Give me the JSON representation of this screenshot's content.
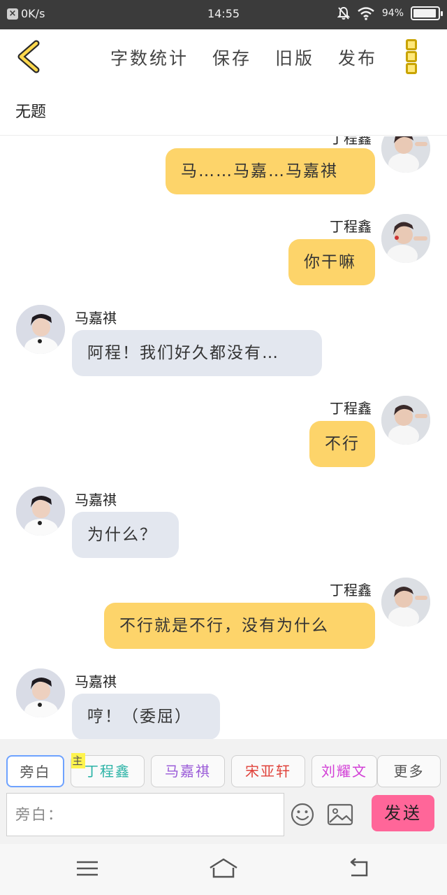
{
  "status_bar": {
    "speed": "0K/s",
    "time": "14:55",
    "battery": "94%",
    "battery_level": 0.94
  },
  "header": {
    "nav": [
      "字数统计",
      "保存",
      "旧版",
      "发布"
    ],
    "title": "无题"
  },
  "messages": [
    {
      "side": "right",
      "name": "丁程鑫",
      "text": "马……马嘉…马嘉祺"
    },
    {
      "side": "right",
      "name": "丁程鑫",
      "text": "你干嘛"
    },
    {
      "side": "left",
      "name": "马嘉祺",
      "text": "阿程！我们好久都没有…"
    },
    {
      "side": "right",
      "name": "丁程鑫",
      "text": "不行"
    },
    {
      "side": "left",
      "name": "马嘉祺",
      "text": "为什么？"
    },
    {
      "side": "right",
      "name": "丁程鑫",
      "text": "不行就是不行，没有为什么"
    },
    {
      "side": "left",
      "name": "马嘉祺",
      "text": "哼！（委屈）"
    }
  ],
  "toolbar": {
    "chips": [
      {
        "label": "旁白",
        "color": "#555555"
      },
      {
        "label": "丁程鑫",
        "color": "#2bb3a6",
        "tag": "主"
      },
      {
        "label": "马嘉祺",
        "color": "#9a5bd8"
      },
      {
        "label": "宋亚轩",
        "color": "#e0423a"
      },
      {
        "label": "刘耀文",
        "color": "#d23fd6"
      }
    ],
    "more_label": "更多",
    "input_placeholder": "旁白：",
    "send_label": "发送"
  },
  "icons": {
    "back": "back-chevron-icon",
    "more": "more-menu-icon",
    "emoji": "emoji-icon",
    "image": "image-icon",
    "nav_menu": "menu-icon",
    "nav_home": "home-icon",
    "nav_back": "back-icon"
  },
  "colors": {
    "accent_yellow": "#fdd46a",
    "bubble_left": "#e3e7ef",
    "send_pink": "#ff6699"
  }
}
